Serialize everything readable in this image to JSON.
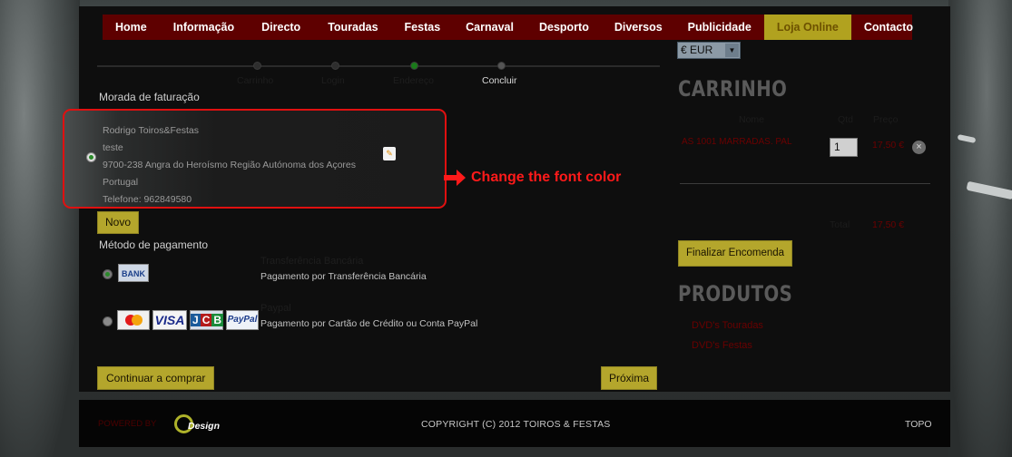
{
  "nav": [
    "Home",
    "Informação",
    "Directo",
    "Touradas",
    "Festas",
    "Carnaval",
    "Desporto",
    "Diversos",
    "Publicidade",
    "Loja Online",
    "Contacto"
  ],
  "currency": "€ EUR",
  "steps": [
    "Carrinho",
    "Login",
    "Endereço",
    "Concluir"
  ],
  "billing": {
    "title": "Morada de faturação",
    "lines": [
      "Rodrigo Toiros&Festas",
      "teste",
      "9700-238 Angra do Heroísmo Região Autónoma dos Açores",
      "Portugal",
      "Telefone: 962849580"
    ],
    "new_button": "Novo"
  },
  "annotation": "Change the font color",
  "payment": {
    "title": "Método de pagamento",
    "options": [
      {
        "title": "Transferência Bancária",
        "desc": "Pagamento por Transferência Bancária",
        "logo": "BANK"
      },
      {
        "title": "Paypal",
        "desc": "Pagamento por Cartão de Crédito ou Conta PayPal",
        "logos": [
          "MasterCard",
          "VISA",
          "JCB",
          "PayPal"
        ]
      }
    ]
  },
  "buttons": {
    "continue": "Continuar a comprar",
    "next": "Próxima",
    "checkout": "Finalizar Encomenda"
  },
  "cart": {
    "title": "CARRINHO",
    "headers": {
      "name": "Nome",
      "qty": "Qtd",
      "price": "Preço"
    },
    "item": {
      "name": "AS 1001 MARRADAS. PAL",
      "qty": "1",
      "price": "17,50 €"
    },
    "total_label": "Total",
    "total": "17,50 €"
  },
  "products": {
    "title": "PRODUTOS",
    "links": [
      "DVD's Touradas",
      "DVD's Festas"
    ]
  },
  "footer": {
    "powered": "POWERED BY",
    "logo_text": "Design",
    "copyright": "COPYRIGHT (C) 2012 TOIROS & FESTAS",
    "top": "TOPO"
  }
}
